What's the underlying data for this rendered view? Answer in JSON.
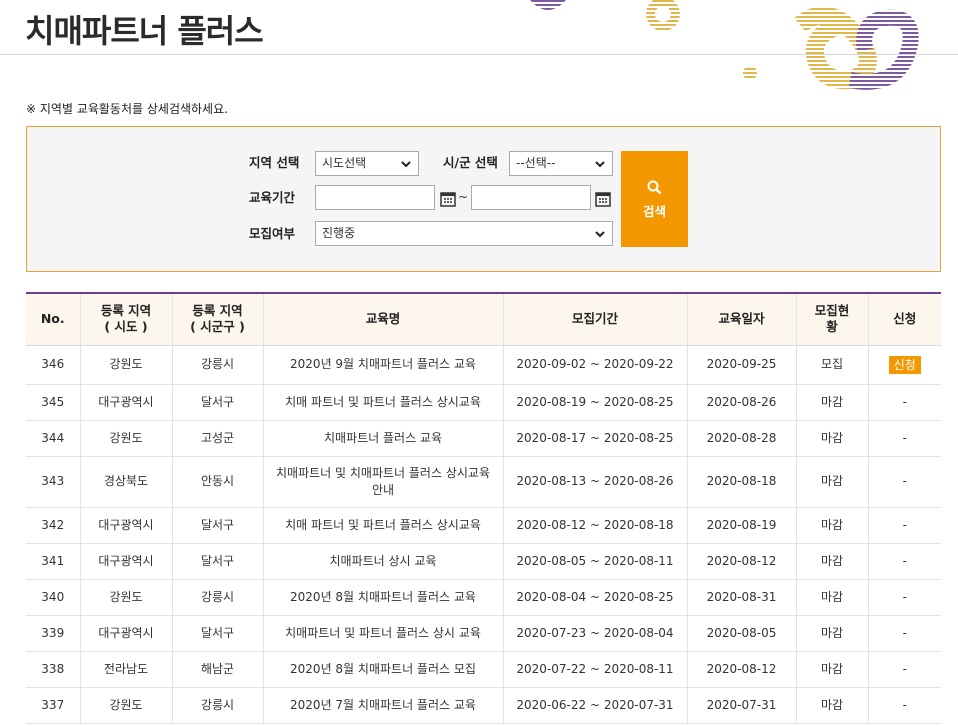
{
  "header": {
    "title": "치매파트너 플러스"
  },
  "notice": "※ 지역별 교육활동처를 상세검색하세요.",
  "search": {
    "region_label": "지역 선택",
    "region_value": "시도선택",
    "city_label": "시/군 선택",
    "city_value": "--선택--",
    "period_label": "교육기간",
    "period_start": "",
    "period_end": "",
    "period_sep": "~",
    "status_label": "모집여부",
    "status_value": "진행중",
    "button_label": "검색"
  },
  "table": {
    "headers": {
      "no": "No.",
      "sido_1": "등록 지역",
      "sido_2": "( 시도 )",
      "sigungu_1": "등록 지역",
      "sigungu_2": "( 시군구 )",
      "name": "교육명",
      "period": "모집기간",
      "date": "교육일자",
      "status_1": "모집현",
      "status_2": "황",
      "apply": "신청"
    },
    "rows": [
      {
        "no": "346",
        "sido": "강원도",
        "sigungu": "강릉시",
        "name": "2020년 9월 치매파트너 플러스 교육",
        "period": "2020-09-02 ~ 2020-09-22",
        "date": "2020-09-25",
        "status": "모집",
        "apply": "신청"
      },
      {
        "no": "345",
        "sido": "대구광역시",
        "sigungu": "달서구",
        "name": "치매 파트너 및 파트너 플러스 상시교육",
        "period": "2020-08-19 ~ 2020-08-25",
        "date": "2020-08-26",
        "status": "마감",
        "apply": "-"
      },
      {
        "no": "344",
        "sido": "강원도",
        "sigungu": "고성군",
        "name": "치매파트너 플러스 교육",
        "period": "2020-08-17 ~ 2020-08-25",
        "date": "2020-08-28",
        "status": "마감",
        "apply": "-"
      },
      {
        "no": "343",
        "sido": "경상북도",
        "sigungu": "안동시",
        "name": "치매파트너 및 치매파트너 플러스 상시교육 안내",
        "period": "2020-08-13 ~ 2020-08-26",
        "date": "2020-08-18",
        "status": "마감",
        "apply": "-"
      },
      {
        "no": "342",
        "sido": "대구광역시",
        "sigungu": "달서구",
        "name": "치매 파트너 및 파트너 플러스 상시교육",
        "period": "2020-08-12 ~ 2020-08-18",
        "date": "2020-08-19",
        "status": "마감",
        "apply": "-"
      },
      {
        "no": "341",
        "sido": "대구광역시",
        "sigungu": "달서구",
        "name": "치매파트너 상시 교육",
        "period": "2020-08-05 ~ 2020-08-11",
        "date": "2020-08-12",
        "status": "마감",
        "apply": "-"
      },
      {
        "no": "340",
        "sido": "강원도",
        "sigungu": "강릉시",
        "name": "2020년 8월 치매파트너 플러스 교육",
        "period": "2020-08-04 ~ 2020-08-25",
        "date": "2020-08-31",
        "status": "마감",
        "apply": "-"
      },
      {
        "no": "339",
        "sido": "대구광역시",
        "sigungu": "달서구",
        "name": "치매파트너 및 파트너 플러스 상시 교육",
        "period": "2020-07-23 ~ 2020-08-04",
        "date": "2020-08-05",
        "status": "마감",
        "apply": "-"
      },
      {
        "no": "338",
        "sido": "전라남도",
        "sigungu": "해남군",
        "name": "2020년 8월 치매파트너 플러스 모집",
        "period": "2020-07-22 ~ 2020-08-11",
        "date": "2020-08-12",
        "status": "마감",
        "apply": "-"
      },
      {
        "no": "337",
        "sido": "강원도",
        "sigungu": "강릉시",
        "name": "2020년 7월 치매파트너 플러스 교육",
        "period": "2020-06-22 ~ 2020-07-31",
        "date": "2020-07-31",
        "status": "마감",
        "apply": "-"
      }
    ]
  },
  "colors": {
    "accent": "#f39800",
    "purple": "#6b3f8f",
    "header_bg": "#fdf6ec",
    "search_bg": "#f5f5f5"
  },
  "icons": {
    "search": "magnifier-icon",
    "calendar": "calendar-icon",
    "dropdown": "chevron-down-icon"
  }
}
